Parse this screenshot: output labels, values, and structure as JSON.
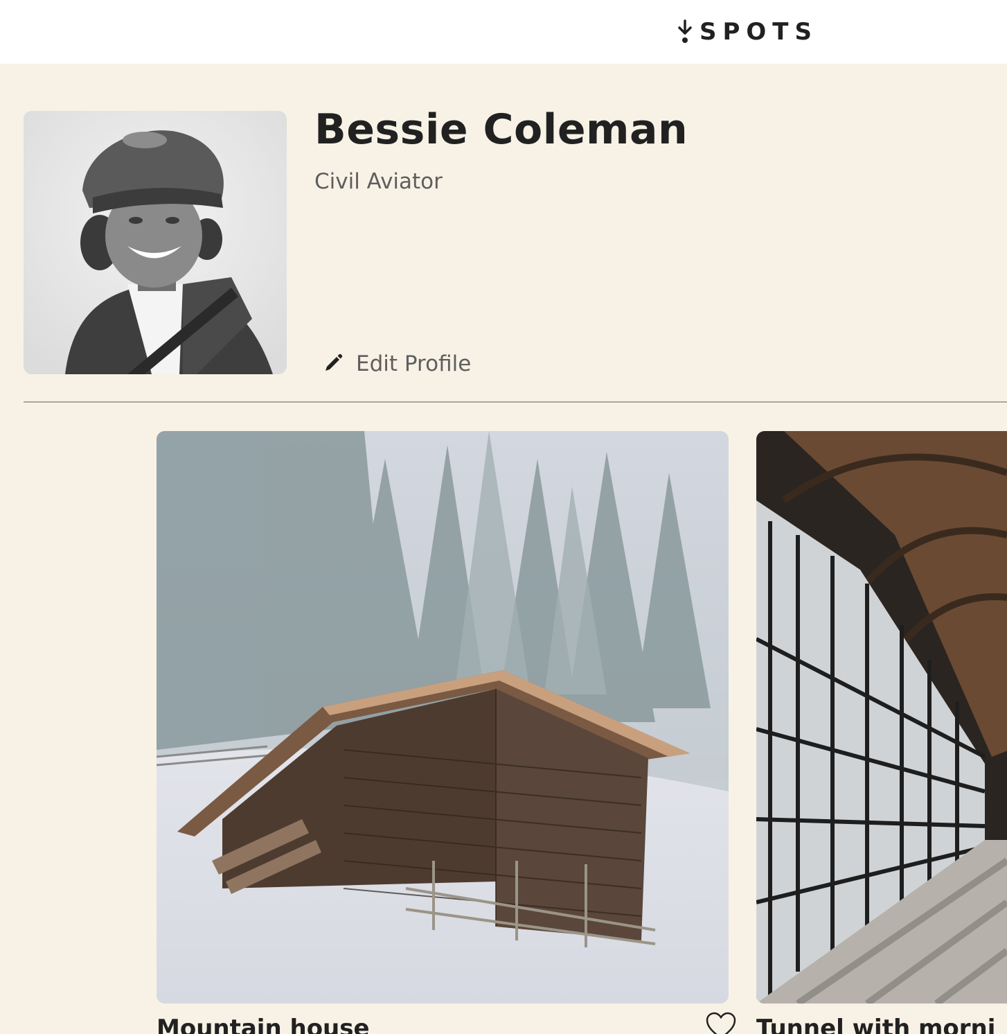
{
  "header": {
    "logo_text": "SPOTS",
    "logo_icon": "spots-logo-icon"
  },
  "profile": {
    "name": "Bessie Coleman",
    "description": "Civil Aviator",
    "avatar_icon": "avatar-photo",
    "edit_label": "Edit Profile",
    "edit_icon": "pencil-icon"
  },
  "cards": [
    {
      "title": "Mountain house",
      "image": "mountain-house-photo",
      "like_icon": "heart-icon"
    },
    {
      "title": "Tunnel with morni",
      "image": "tunnel-photo"
    }
  ],
  "colors": {
    "page_background": "#f8f2e6",
    "header_background": "#ffffff",
    "text_primary": "#212121",
    "text_secondary": "#5e5e5e",
    "divider": "#a8a89a"
  }
}
